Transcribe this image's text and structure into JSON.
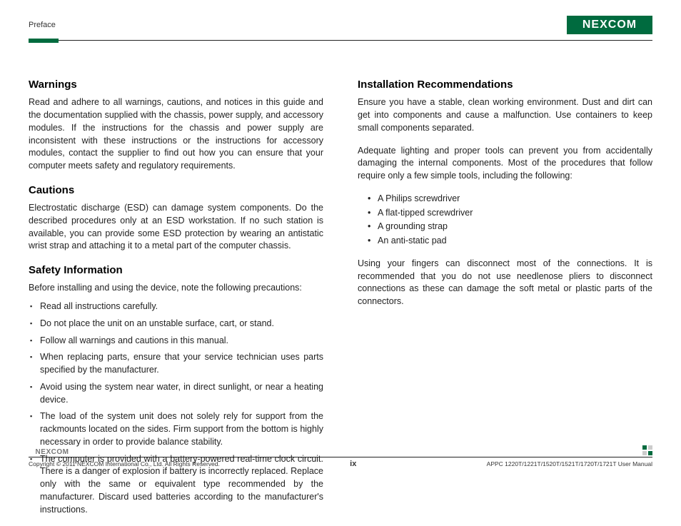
{
  "header": {
    "preface": "Preface",
    "logo": "NEXCOM"
  },
  "left": {
    "warnings": {
      "title": "Warnings",
      "body": "Read and adhere to all warnings, cautions, and notices in this guide and the documentation supplied with the chassis, power supply, and accessory modules. If the instructions for the chassis and power supply are inconsistent with these instructions or the instructions for accessory modules, contact the supplier to find out how you can ensure that your computer meets safety and regulatory requirements."
    },
    "cautions": {
      "title": "Cautions",
      "body": "Electrostatic discharge (ESD) can damage system components. Do the described procedures only at an ESD workstation. If no such station is available, you can provide some ESD protection by wearing an antistatic wrist strap and attaching it to a metal part of the computer chassis."
    },
    "safety": {
      "title": "Safety Information",
      "intro": "Before installing and using the device, note the following precautions:",
      "items": [
        "Read all instructions carefully.",
        "Do not place the unit on an unstable surface, cart, or stand.",
        "Follow all warnings and cautions in this manual.",
        "When replacing parts, ensure that your service technician uses parts specified by the manufacturer.",
        "Avoid using the system near water, in direct sunlight, or near a heating device.",
        "The load of the system unit does not solely rely for support from the rackmounts located on the sides. Firm support from the bottom is highly necessary in order to provide balance stability.",
        "The computer is provided with a battery-powered real-time clock circuit. There is a danger of explosion if battery is incorrectly replaced. Replace only with the same or equivalent type recommended by the manufacturer. Discard used batteries according to the manufacturer's instructions."
      ]
    }
  },
  "right": {
    "install": {
      "title": "Installation Recommendations",
      "p1": "Ensure you have a stable, clean working environment. Dust and dirt can get into components and cause a malfunction. Use containers to keep small components separated.",
      "p2": "Adequate lighting and proper tools can prevent you from accidentally damaging the internal components. Most of the procedures that follow require only a few simple tools, including the following:",
      "tools": [
        "A Philips screwdriver",
        "A flat-tipped screwdriver",
        "A grounding strap",
        "An anti-static pad"
      ],
      "p3": "Using your fingers can disconnect most of the connections. It is recommended that you do not use needlenose pliers to disconnect connections as these can damage the soft metal or plastic parts of the connectors."
    }
  },
  "footer": {
    "logo": "NEXCOM",
    "copyright": "Copyright © 2011 NEXCOM International Co., Ltd. All Rights Reserved.",
    "page": "ix",
    "doc": "APPC 1220T/1221T/1520T/1521T/1720T/1721T User Manual"
  }
}
